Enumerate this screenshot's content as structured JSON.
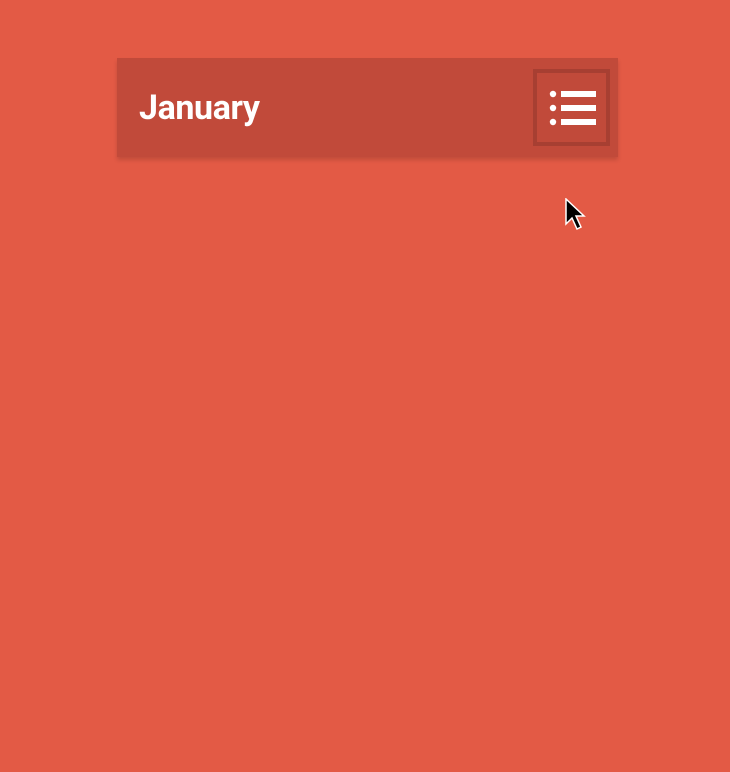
{
  "header": {
    "title": "January"
  },
  "icons": {
    "menu": "list-menu-icon"
  },
  "colors": {
    "background": "#e35a45",
    "headerBar": "#c14a3a",
    "buttonBorder": "#a73f32",
    "text": "#ffffff"
  }
}
